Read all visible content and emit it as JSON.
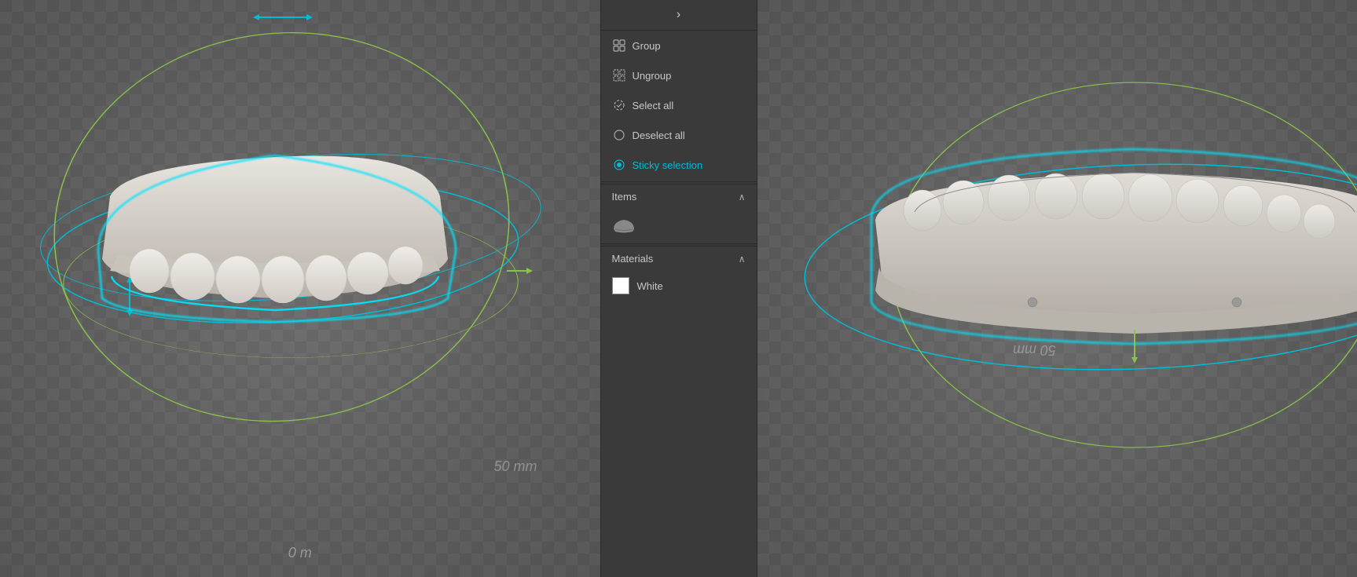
{
  "panel": {
    "collapse_icon": "›",
    "items": [
      {
        "id": "group",
        "label": "Group",
        "icon": "group"
      },
      {
        "id": "ungroup",
        "label": "Ungroup",
        "icon": "ungroup"
      },
      {
        "id": "select-all",
        "label": "Select all",
        "icon": "select-all"
      },
      {
        "id": "deselect-all",
        "label": "Deselect all",
        "icon": "deselect-all"
      },
      {
        "id": "sticky-selection",
        "label": "Sticky selection",
        "icon": "sticky",
        "active": true
      }
    ],
    "sections": {
      "items": {
        "label": "Items",
        "collapsed": false
      },
      "materials": {
        "label": "Materials",
        "collapsed": false
      }
    },
    "materials": [
      {
        "name": "White",
        "color": "#ffffff"
      }
    ]
  },
  "viewport": {
    "left": {
      "measure": "50 mm",
      "measure2": "0 m"
    },
    "right": {
      "measure": "50 mm"
    }
  }
}
